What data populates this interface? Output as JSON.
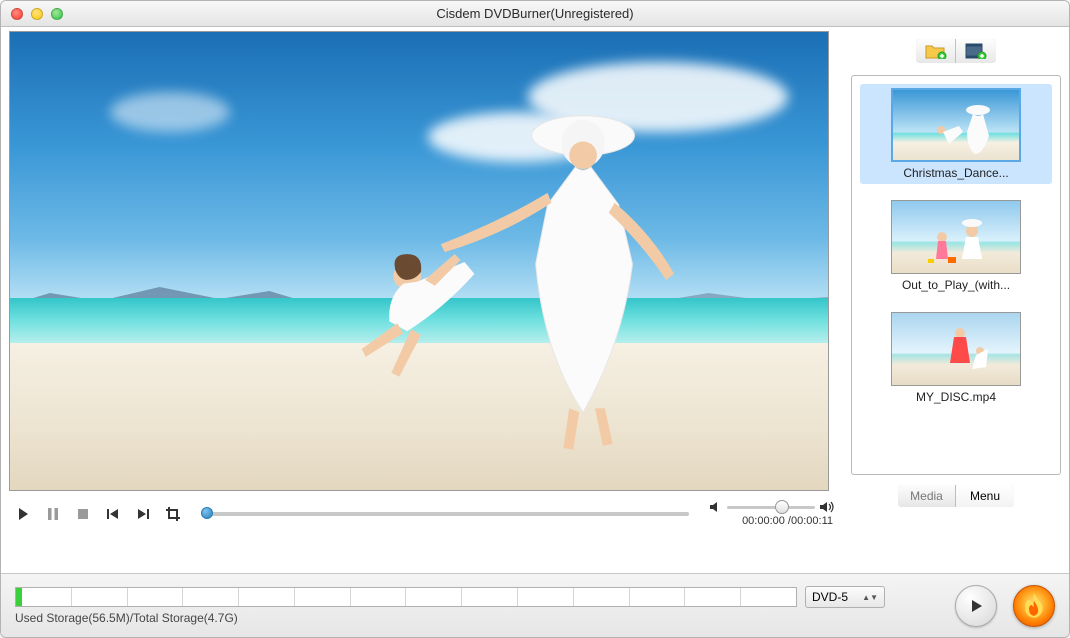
{
  "window": {
    "title": "Cisdem DVDBurner(Unregistered)"
  },
  "playback": {
    "position_pct": 0,
    "current_time": "00:00:00",
    "total_time": "00:00:11",
    "time_display": "00:00:00 /00:00:11",
    "volume_pct": 55
  },
  "media_items": [
    {
      "label": "Christmas_Dance...",
      "selected": true
    },
    {
      "label": "Out_to_Play_(with...",
      "selected": false
    },
    {
      "label": "MY_DISC.mp4",
      "selected": false
    }
  ],
  "tabs": {
    "media": "Media",
    "menu": "Menu",
    "active": "menu"
  },
  "storage": {
    "used": "56.5M",
    "total": "4.7G",
    "label": "Used Storage(56.5M)/Total Storage(4.7G)",
    "percent": 1.2,
    "segments": 14
  },
  "disc": {
    "selected": "DVD-5"
  },
  "icons": {
    "add_folder": "folder-add-icon",
    "add_video": "video-add-icon",
    "play": "play-icon",
    "pause": "pause-icon",
    "stop": "stop-icon",
    "prev": "prev-icon",
    "next": "next-icon",
    "crop": "crop-icon",
    "vol_down": "volume-down-icon",
    "vol_up": "volume-up-icon",
    "preview_play": "preview-play-icon",
    "burn": "burn-icon"
  }
}
